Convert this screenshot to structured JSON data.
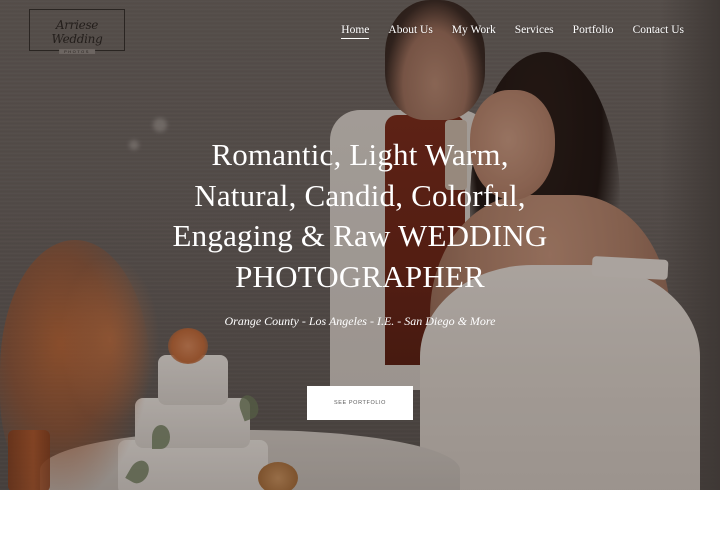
{
  "brand": {
    "logo_script": "Arriese Wedding",
    "logo_sub": "PHOTOS"
  },
  "nav": {
    "items": [
      {
        "label": "Home",
        "active": true
      },
      {
        "label": "About Us",
        "active": false
      },
      {
        "label": "My Work",
        "active": false
      },
      {
        "label": "Services",
        "active": false
      },
      {
        "label": "Portfolio",
        "active": false
      },
      {
        "label": "Contact Us",
        "active": false
      }
    ]
  },
  "hero": {
    "headline_lines": [
      "Romantic, Light Warm,",
      "Natural, Candid, Colorful,",
      "Engaging & Raw WEDDING",
      "PHOTOGRAPHER"
    ],
    "tagline": "Orange County - Los Angeles - I.E. - San Diego & More",
    "cta_label": "SEE PORTFOLIO",
    "background_description": "Bride and groom cutting a tiered wedding cake beside a dried orange floral arrangement"
  },
  "colors": {
    "text_on_hero": "#ffffff",
    "cta_background": "#ffffff",
    "cta_text": "#5a5a5a",
    "page_background": "#ffffff"
  }
}
